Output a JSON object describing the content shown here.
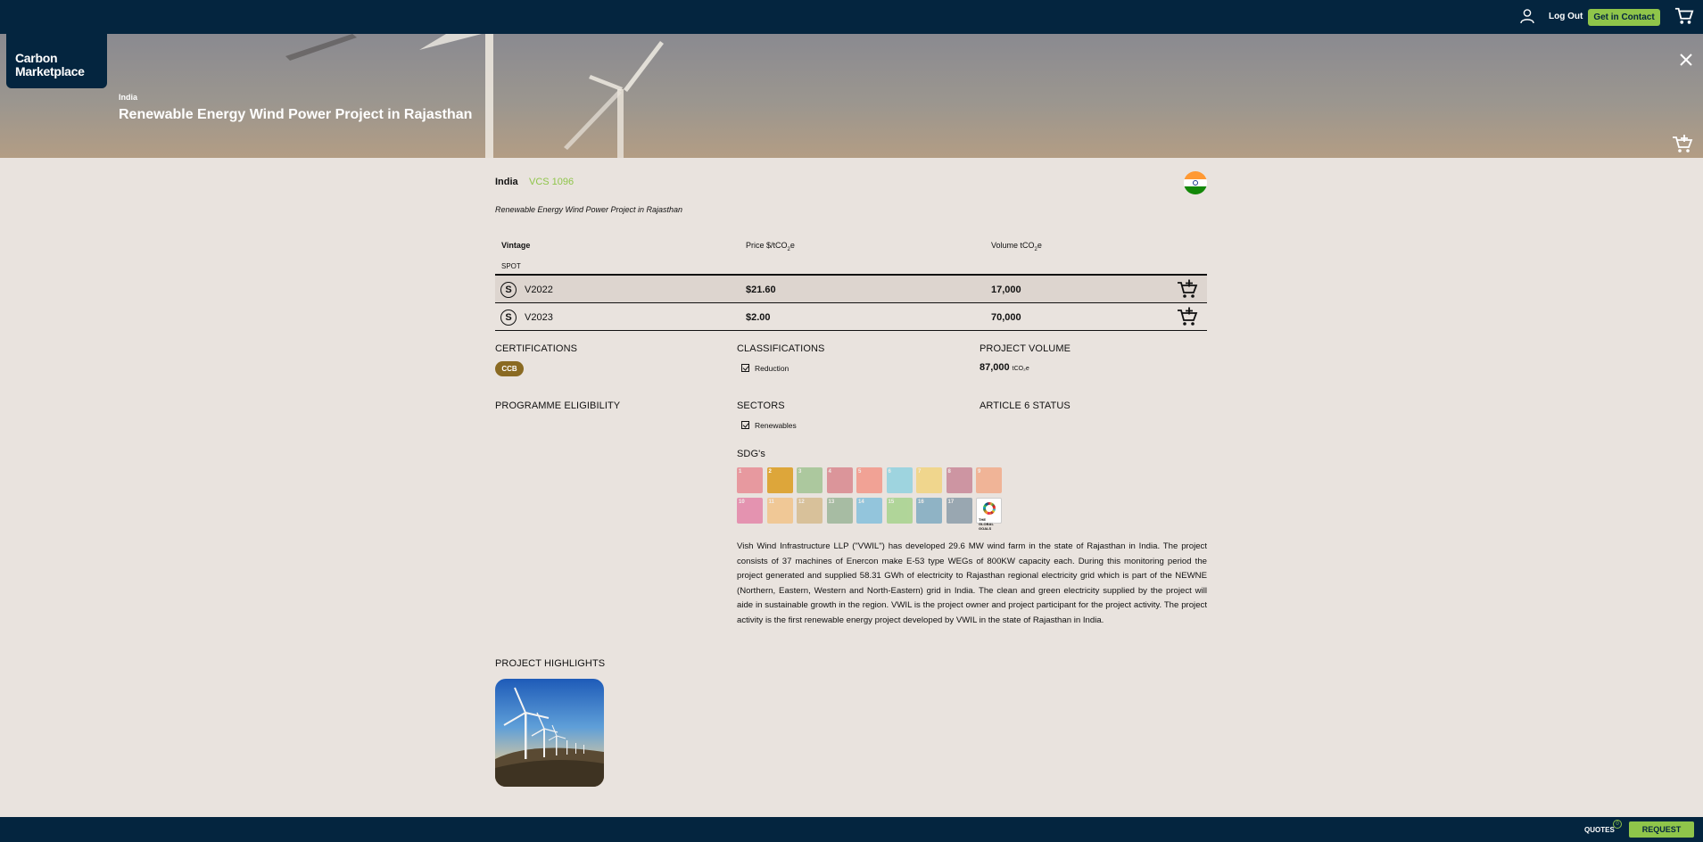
{
  "nav": {
    "logout_label": "Log Out",
    "contact_label": "Get in Contact",
    "user_icon": "user-icon",
    "cart_icon": "cart-icon"
  },
  "hero": {
    "logo_line1": "Carbon",
    "logo_line2": "Marketplace",
    "country": "India",
    "title": "Renewable Energy Wind Power Project in Rajasthan"
  },
  "project": {
    "country": "India",
    "registry_id": "VCS 1096",
    "subtitle": "Renewable Energy Wind Power Project in Rajasthan",
    "flag_icon": "india-flag-icon"
  },
  "table": {
    "col_vintage": "Vintage",
    "col_price": "Price $/tCO",
    "col_price_sub": "2",
    "col_price_end": "e",
    "col_volume": "Volume tCO",
    "col_volume_sub": "2",
    "col_volume_end": "e",
    "group_label": "SPOT",
    "rows": [
      {
        "badge": "S",
        "vintage": "V2022",
        "price": "$21.60",
        "volume": "17,000"
      },
      {
        "badge": "S",
        "vintage": "V2023",
        "price": "$2.00",
        "volume": "70,000"
      }
    ]
  },
  "sections": {
    "certifications": "CERTIFICATIONS",
    "certification_badge": "CCB",
    "classifications": "CLASSIFICATIONS",
    "classification_item": "Reduction",
    "project_volume": "PROJECT VOLUME",
    "project_volume_value": "87,000",
    "project_volume_unit": "tCO₂e",
    "programme_eligibility": "PROGRAMME ELIGIBILITY",
    "sectors": "SECTORS",
    "sector_item": "Renewables",
    "article6": "ARTICLE 6 STATUS",
    "sdgs": "SDG's",
    "highlights": "PROJECT HIGHLIGHTS"
  },
  "sdg_tiles": [
    {
      "num": "1",
      "color": "#e5243b",
      "active": false
    },
    {
      "num": "2",
      "color": "#dda63a",
      "active": true
    },
    {
      "num": "3",
      "color": "#4c9f38",
      "active": false
    },
    {
      "num": "4",
      "color": "#c5192d",
      "active": false
    },
    {
      "num": "5",
      "color": "#ff3a21",
      "active": false
    },
    {
      "num": "6",
      "color": "#26bde2",
      "active": false
    },
    {
      "num": "7",
      "color": "#fcc30b",
      "active": false
    },
    {
      "num": "8",
      "color": "#a21942",
      "active": false
    },
    {
      "num": "9",
      "color": "#fd6925",
      "active": false
    },
    {
      "num": "10",
      "color": "#dd1367",
      "active": false
    },
    {
      "num": "11",
      "color": "#fd9d24",
      "active": false
    },
    {
      "num": "12",
      "color": "#bf8b2e",
      "active": false
    },
    {
      "num": "13",
      "color": "#3f7e44",
      "active": false
    },
    {
      "num": "14",
      "color": "#0a97d9",
      "active": false
    },
    {
      "num": "15",
      "color": "#56c02b",
      "active": false
    },
    {
      "num": "16",
      "color": "#00689d",
      "active": false
    },
    {
      "num": "17",
      "color": "#19486a",
      "active": false
    }
  ],
  "sdg_global_label": "THE GLOBAL GOALS",
  "description": "Vish Wind Infrastructure LLP (\"VWIL\") has developed 29.6 MW wind farm in the state of Rajasthan in India. The project consists of 37 machines of Enercon make E-53 type WEGs of 800KW capacity each. During this monitoring period the project generated and supplied 58.31 GWh of electricity to Rajasthan regional electricity grid which is part of the NEWNE (Northern, Eastern, Western and North-Eastern) grid in India. The clean and green electricity supplied by the project will aide in sustainable growth in the region. VWIL is the project owner and project participant for the project activity. The project activity is the first renewable energy project developed by VWIL in the state of Rajasthan in India.",
  "bottom": {
    "quotes_label": "QUOTES",
    "quotes_count": "0",
    "request_label": "REQUEST"
  }
}
